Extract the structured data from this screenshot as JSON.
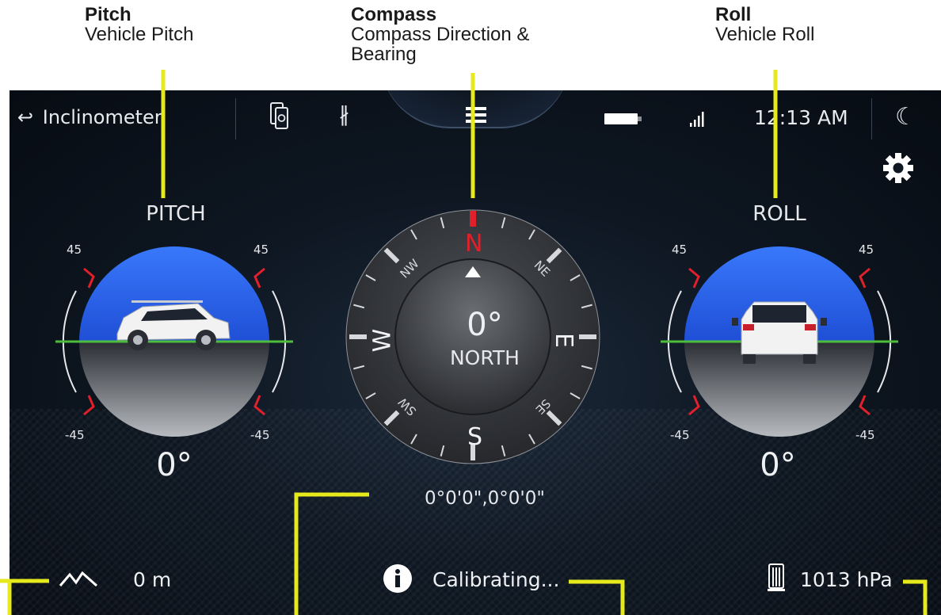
{
  "callouts": {
    "pitch": {
      "title": "Pitch",
      "desc": "Vehicle Pitch"
    },
    "compass": {
      "title": "Compass",
      "desc1": "Compass Direction &",
      "desc2": "Bearing"
    },
    "roll": {
      "title": "Roll",
      "desc": "Vehicle Roll"
    }
  },
  "topbar": {
    "back_label": "Inclinometer",
    "time": "12:13 AM",
    "icons": [
      "back-arrow-icon",
      "phone-sync-icon",
      "bluetooth-icon",
      "menu-icon",
      "battery-icon",
      "signal-icon",
      "night-mode-icon",
      "settings-gear-icon"
    ]
  },
  "pitch": {
    "label": "PITCH",
    "top_left": "45",
    "top_right": "45",
    "bottom_left": "-45",
    "bottom_right": "-45",
    "value": "0°"
  },
  "roll": {
    "label": "ROLL",
    "top_left": "45",
    "top_right": "45",
    "bottom_left": "-45",
    "bottom_right": "-45",
    "value": "0°"
  },
  "compass": {
    "cardinals": {
      "n": "N",
      "e": "E",
      "s": "S",
      "w": "W"
    },
    "intercardinals": {
      "nw": "NW",
      "ne": "NE",
      "sw": "SW",
      "se": "SE"
    },
    "heading": "0°",
    "direction": "NORTH",
    "coordinates": "0°0'0\",0°0'0\""
  },
  "bottom": {
    "altitude": "0 m",
    "status": "Calibrating...",
    "pressure": "1013 hPa"
  },
  "colors": {
    "accent_red": "#e0202a",
    "sky_blue": "#2f6bf5",
    "horizon_green": "#4cbe3c",
    "callout_yellow": "#e6ea1c"
  }
}
